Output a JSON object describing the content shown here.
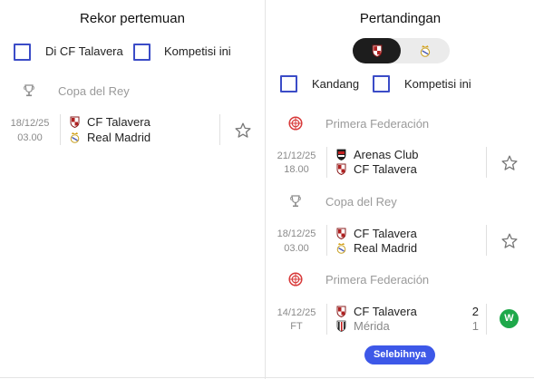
{
  "left": {
    "title": "Rekor pertemuan",
    "filters": [
      {
        "label": "Di CF Talavera",
        "checked": false
      },
      {
        "label": "Kompetisi ini",
        "checked": false
      }
    ],
    "groups": [
      {
        "competition": "Copa del Rey",
        "competition_icon": "copa-del-rey-icon",
        "matches": [
          {
            "date": "18/12/25",
            "time": "03.00",
            "home": "CF Talavera",
            "away": "Real Madrid",
            "favorite": false
          }
        ]
      }
    ]
  },
  "right": {
    "title": "Pertandingan",
    "team_toggle": {
      "options": [
        "cf-talavera-crest-icon",
        "real-madrid-crest-icon"
      ],
      "selected": 0
    },
    "filters": [
      {
        "label": "Kandang",
        "checked": false
      },
      {
        "label": "Kompetisi ini",
        "checked": false
      }
    ],
    "groups": [
      {
        "competition": "Primera Federación",
        "competition_icon": "primera-federacion-icon",
        "match": {
          "date": "21/12/25",
          "time": "18.00",
          "home": "Arenas Club",
          "away": "CF Talavera",
          "favorite": false
        }
      },
      {
        "competition": "Copa del Rey",
        "competition_icon": "copa-del-rey-icon",
        "match": {
          "date": "18/12/25",
          "time": "03.00",
          "home": "CF Talavera",
          "away": "Real Madrid",
          "favorite": false
        }
      },
      {
        "competition": "Primera Federación",
        "competition_icon": "primera-federacion-icon",
        "match": {
          "date": "14/12/25",
          "time": "FT",
          "home": "CF Talavera",
          "away": "Mérida",
          "home_score": "2",
          "away_score": "1",
          "result": "W"
        }
      }
    ],
    "more_label": "Selebihnya"
  },
  "colors": {
    "accent": "#3b4cc7",
    "button": "#3d58e8",
    "win": "#1ea84a"
  }
}
